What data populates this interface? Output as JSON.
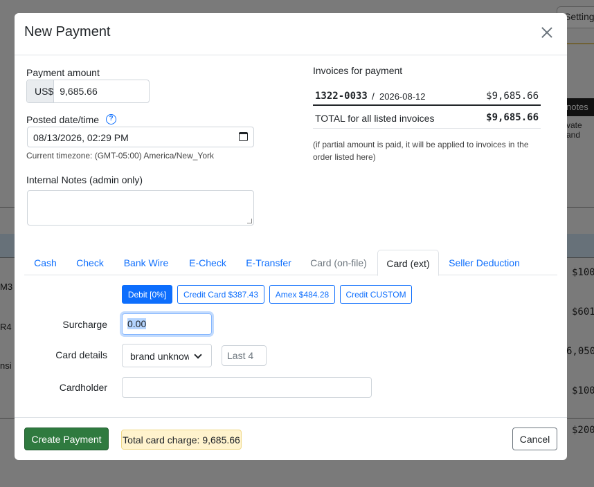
{
  "background": {
    "top_button": "Setting",
    "notes_button": "notes",
    "side_text": "vate and",
    "left_fragments": [
      "M3",
      "R4",
      "nsi"
    ],
    "right_fragments": [
      "$100",
      "$601",
      "6,050",
      "$100",
      "$200"
    ]
  },
  "modal": {
    "title": "New Payment",
    "payment_amount_label": "Payment amount",
    "currency_prefix": "US$",
    "amount_value": "9,685.66",
    "posted_label": "Posted date/time",
    "posted_value": "08/13/2026, 02:29 PM",
    "timezone_text": "Current timezone: (GMT-05:00) America/New_York",
    "notes_label": "Internal Notes (admin only)",
    "notes_value": ""
  },
  "invoices": {
    "title": "Invoices for payment",
    "rows": [
      {
        "number": "1322-0033",
        "separator": "/",
        "date": "2026-08-12",
        "amount": "$9,685.66"
      }
    ],
    "total_label": "TOTAL for all listed invoices",
    "total_amount": "$9,685.66",
    "note": "(if partial amount is paid, it will be applied to invoices in the order listed here)"
  },
  "tabs": [
    {
      "label": "Cash",
      "state": "link"
    },
    {
      "label": "Check",
      "state": "link"
    },
    {
      "label": "Bank Wire",
      "state": "link"
    },
    {
      "label": "E-Check",
      "state": "link"
    },
    {
      "label": "E-Transfer",
      "state": "link"
    },
    {
      "label": "Card (on-file)",
      "state": "disabled"
    },
    {
      "label": "Card (ext)",
      "state": "active"
    },
    {
      "label": "Seller Deduction",
      "state": "link"
    }
  ],
  "card_options": {
    "debit": "Debit [0%]",
    "credit": "Credit Card $387.43",
    "amex": "Amex $484.28",
    "custom": "Credit CUSTOM"
  },
  "card_form": {
    "surcharge_label": "Surcharge",
    "surcharge_value": "0.00",
    "card_details_label": "Card details",
    "brand_value": "brand unknown",
    "last4_placeholder": "Last 4",
    "cardholder_label": "Cardholder",
    "cardholder_value": ""
  },
  "footer": {
    "create_button": "Create Payment",
    "total_charge": "Total card charge: 9,685.66",
    "cancel_button": "Cancel"
  },
  "colors": {
    "primary": "#0d6efd",
    "success": "#2f7a3f",
    "warning_bg": "#fff3cd"
  }
}
